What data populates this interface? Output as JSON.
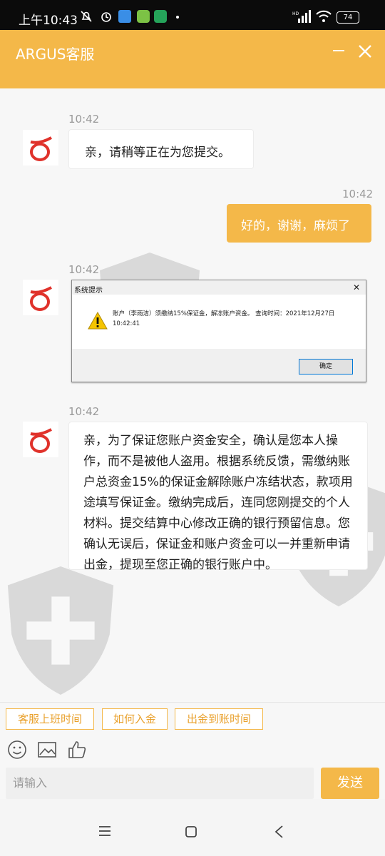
{
  "status_bar": {
    "time": "上午10:43",
    "battery": "74"
  },
  "header": {
    "title": "ARGUS客服"
  },
  "messages": [
    {
      "time": "10:42",
      "text": "亲，请稍等正在为您提交。"
    },
    {
      "time": "10:42",
      "text": "好的，谢谢，麻烦了"
    },
    {
      "time": "10:42",
      "dialog": {
        "title": "系统提示",
        "body": "账户（李雨洁）须缴纳15%保证金，解冻账户资金。       查询时间：2021年12月27日10:42:41",
        "button": "确定"
      }
    },
    {
      "time": "10:42",
      "text": "亲，为了保证您账户资金安全，确认是您本人操作，而不是被他人盗用。根据系统反馈，需缴纳账户总资金15%的保证金解除账户冻结状态，款项用途填写保证金。缴纳完成后，连同您刚提交的个人材料。提交结算中心修改正确的银行预留信息。您确认无误后，保证金和账户资金可以一并重新申请出金，提现至您正确的银行账户中。"
    }
  ],
  "quick_replies": [
    "客服上班时间",
    "如何入金",
    "出金到账时间"
  ],
  "input": {
    "placeholder": "请输入"
  },
  "send_label": "发送",
  "colors": {
    "accent": "#f4b849",
    "avatar_red": "#e0322b"
  }
}
